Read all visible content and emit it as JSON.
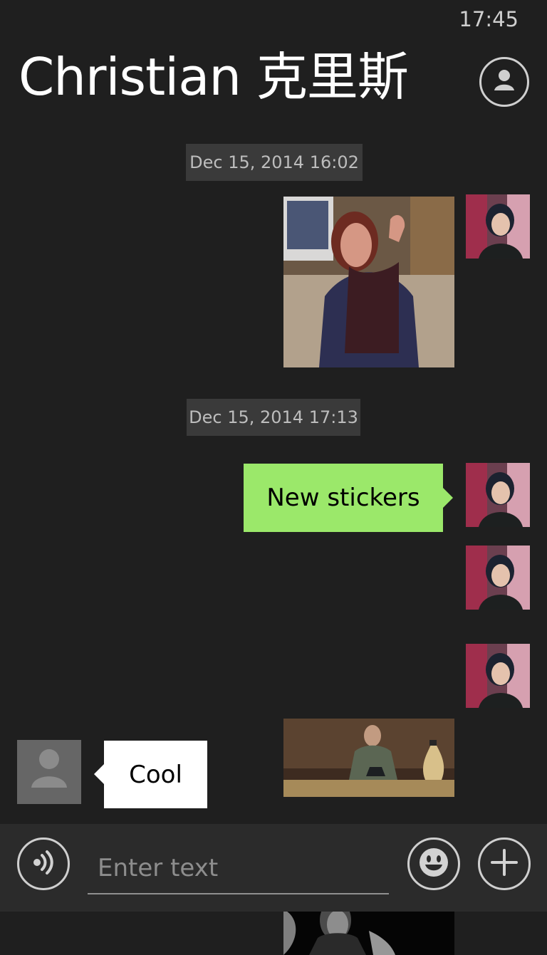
{
  "status": {
    "time": "17:45"
  },
  "header": {
    "title": "Christian 克里斯",
    "contact_icon": "person-icon"
  },
  "messages": {
    "timestamps": [
      "Dec 15, 2014 16:02",
      "Dec 15, 2014 17:13"
    ],
    "outgoing_text": "New stickers",
    "incoming_text": "Cool"
  },
  "composer": {
    "placeholder": "Enter text",
    "voice_icon": "voice-icon",
    "emoji_icon": "emoji-icon",
    "add_icon": "plus-icon"
  },
  "colors": {
    "background": "#1f1f1f",
    "outgoing_bubble": "#9be86a",
    "incoming_bubble": "#ffffff",
    "timestamp_bg": "#3a3a3a"
  }
}
